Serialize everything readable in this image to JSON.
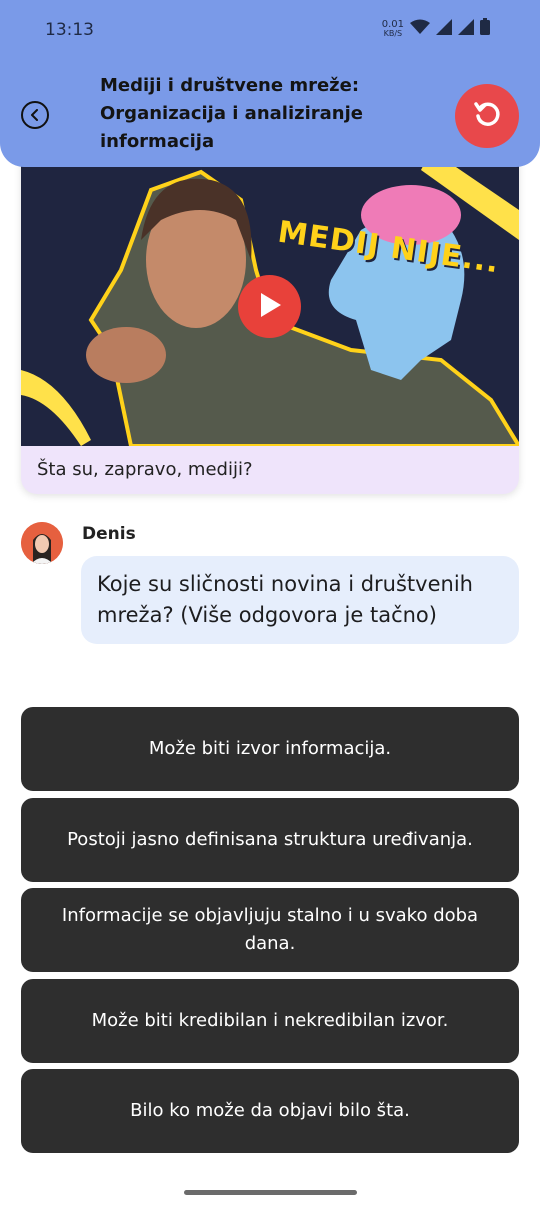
{
  "status_bar": {
    "time": "13:13",
    "net_speed_value": "0.01",
    "net_speed_unit": "KB/S"
  },
  "header": {
    "title": "Mediji i društvene mreže: Organizacija i analiziranje informacija"
  },
  "video": {
    "overlay_text": "MEDIJ NIJE...",
    "caption": "Šta su, zapravo, mediji?"
  },
  "chat": {
    "author": "Denis",
    "message": "Koje su sličnosti novina i društvenih mreža? (Više odgovora je tačno)"
  },
  "answers": [
    {
      "label": "Može biti izvor informacija."
    },
    {
      "label": "Postoji jasno definisana struktura uređivanja."
    },
    {
      "label": "Informacije se objavljuju stalno i u svako doba dana."
    },
    {
      "label": "Može biti kredibilan i nekredibilan izvor."
    },
    {
      "label": "Bilo ko može da objavi bilo šta."
    }
  ],
  "colors": {
    "header_bg": "#7a9ae8",
    "reset_button": "#e8484b",
    "answer_bg": "#2e2e2e",
    "bubble_bg": "#e6eefc",
    "caption_bg": "#efe4fb"
  },
  "icons": {
    "back": "back-arrow-icon",
    "reset": "reset-icon",
    "play": "play-icon",
    "wifi": "wifi-icon",
    "signal": "signal-icon",
    "battery": "battery-icon"
  }
}
